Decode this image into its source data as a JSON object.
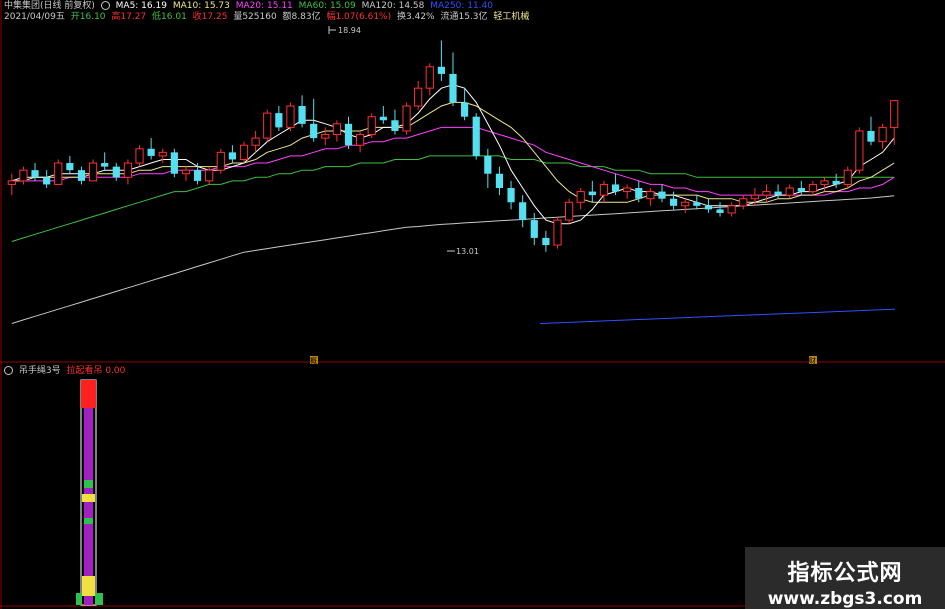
{
  "header": {
    "title": "中集集团(日线 前复权)",
    "ma5": "MA5: 16.19",
    "ma10": "MA10: 15.73",
    "ma20": "MA20: 15.11",
    "ma60": "MA60: 15.09",
    "ma120": "MA120: 14.58",
    "ma250": "MA250: 11.40",
    "date": "2021/04/09五",
    "open": "开16.10",
    "high": "高17.27",
    "low": "低16.01",
    "close": "收17.25",
    "volume": "量525160",
    "amount": "额8.83亿",
    "change": "幅1.07(6.61%)",
    "turnover": "换3.42%",
    "float": "流通15.3亿",
    "industry": "轻工机械"
  },
  "annotations": {
    "high_mark": "18.94",
    "low_mark": "13.01",
    "marker_left": "概",
    "marker_right": "财"
  },
  "sub_chart": {
    "name": "吊手绳3号",
    "indicator": "拉起看吊 0.00"
  },
  "watermark": {
    "line1": "指标公式网",
    "line2": "www.zbgs3.com"
  },
  "colors": {
    "up": "#ff3030",
    "down": "#54e0f0",
    "ma5": "#ffffff",
    "ma10": "#f0e68c",
    "ma20": "#ff40ff",
    "ma60": "#40c040",
    "ma120": "#c8c8c8",
    "ma250": "#3050ff",
    "grid": "#8b0000"
  },
  "chart_data": {
    "type": "candlestick",
    "ylim": [
      10.2,
      19.4
    ],
    "candles": [
      [
        14.9,
        15.2,
        14.6,
        15.0
      ],
      [
        15.0,
        15.4,
        14.9,
        15.3
      ],
      [
        15.3,
        15.5,
        15.0,
        15.1
      ],
      [
        15.1,
        15.3,
        14.8,
        14.9
      ],
      [
        14.9,
        15.6,
        14.9,
        15.5
      ],
      [
        15.5,
        15.7,
        15.2,
        15.3
      ],
      [
        15.3,
        15.4,
        14.9,
        15.0
      ],
      [
        15.0,
        15.6,
        15.0,
        15.5
      ],
      [
        15.5,
        15.8,
        15.3,
        15.4
      ],
      [
        15.4,
        15.5,
        15.0,
        15.1
      ],
      [
        15.1,
        15.6,
        14.9,
        15.5
      ],
      [
        15.5,
        16.0,
        15.4,
        15.9
      ],
      [
        15.9,
        16.2,
        15.6,
        15.7
      ],
      [
        15.7,
        15.9,
        15.5,
        15.8
      ],
      [
        15.8,
        15.9,
        15.1,
        15.2
      ],
      [
        15.2,
        15.4,
        15.0,
        15.3
      ],
      [
        15.3,
        15.5,
        14.9,
        15.0
      ],
      [
        15.0,
        15.4,
        14.9,
        15.3
      ],
      [
        15.3,
        15.9,
        15.2,
        15.8
      ],
      [
        15.8,
        16.0,
        15.5,
        15.6
      ],
      [
        15.6,
        16.1,
        15.5,
        16.0
      ],
      [
        16.0,
        16.4,
        15.8,
        16.2
      ],
      [
        16.2,
        17.0,
        16.1,
        16.9
      ],
      [
        16.9,
        17.1,
        16.4,
        16.5
      ],
      [
        16.5,
        17.2,
        16.4,
        17.1
      ],
      [
        17.1,
        17.4,
        16.5,
        16.6
      ],
      [
        16.6,
        17.3,
        16.1,
        16.2
      ],
      [
        16.2,
        16.5,
        16.0,
        16.3
      ],
      [
        16.3,
        16.7,
        16.1,
        16.6
      ],
      [
        16.6,
        16.8,
        15.9,
        16.0
      ],
      [
        16.0,
        16.4,
        15.8,
        16.3
      ],
      [
        16.3,
        16.9,
        16.2,
        16.8
      ],
      [
        16.8,
        17.1,
        16.6,
        16.7
      ],
      [
        16.7,
        17.0,
        16.3,
        16.4
      ],
      [
        16.4,
        17.2,
        16.3,
        17.1
      ],
      [
        17.1,
        17.8,
        17.0,
        17.6
      ],
      [
        17.6,
        18.3,
        17.4,
        18.2
      ],
      [
        18.2,
        18.94,
        17.8,
        18.0
      ],
      [
        18.0,
        18.6,
        17.1,
        17.2
      ],
      [
        17.2,
        17.6,
        16.7,
        16.8
      ],
      [
        16.8,
        16.9,
        15.6,
        15.7
      ],
      [
        15.7,
        15.9,
        14.8,
        15.2
      ],
      [
        15.2,
        15.4,
        14.6,
        14.8
      ],
      [
        14.8,
        15.0,
        14.2,
        14.4
      ],
      [
        14.4,
        14.6,
        13.7,
        13.9
      ],
      [
        13.9,
        14.1,
        13.2,
        13.4
      ],
      [
        13.4,
        13.6,
        13.01,
        13.2
      ],
      [
        13.2,
        14.0,
        13.1,
        13.9
      ],
      [
        13.9,
        14.5,
        13.8,
        14.4
      ],
      [
        14.4,
        14.8,
        14.2,
        14.7
      ],
      [
        14.7,
        15.0,
        14.4,
        14.6
      ],
      [
        14.6,
        15.0,
        14.4,
        14.9
      ],
      [
        14.9,
        15.2,
        14.6,
        14.7
      ],
      [
        14.7,
        14.9,
        14.5,
        14.8
      ],
      [
        14.8,
        15.0,
        14.4,
        14.5
      ],
      [
        14.5,
        14.8,
        14.3,
        14.7
      ],
      [
        14.7,
        14.9,
        14.4,
        14.5
      ],
      [
        14.5,
        14.7,
        14.2,
        14.3
      ],
      [
        14.3,
        14.5,
        14.1,
        14.4
      ],
      [
        14.4,
        14.6,
        14.2,
        14.3
      ],
      [
        14.3,
        14.5,
        14.1,
        14.2
      ],
      [
        14.2,
        14.4,
        14.0,
        14.1
      ],
      [
        14.1,
        14.4,
        14.0,
        14.3
      ],
      [
        14.3,
        14.6,
        14.2,
        14.5
      ],
      [
        14.5,
        14.8,
        14.3,
        14.6
      ],
      [
        14.6,
        14.9,
        14.4,
        14.7
      ],
      [
        14.7,
        14.9,
        14.5,
        14.6
      ],
      [
        14.6,
        14.9,
        14.5,
        14.8
      ],
      [
        14.8,
        15.0,
        14.6,
        14.7
      ],
      [
        14.7,
        15.0,
        14.6,
        14.9
      ],
      [
        14.9,
        15.1,
        14.7,
        15.0
      ],
      [
        15.0,
        15.2,
        14.8,
        14.9
      ],
      [
        14.9,
        15.4,
        14.8,
        15.3
      ],
      [
        15.3,
        16.5,
        15.2,
        16.4
      ],
      [
        16.4,
        16.8,
        16.0,
        16.1
      ],
      [
        16.1,
        16.6,
        15.9,
        16.5
      ],
      [
        16.5,
        17.27,
        16.01,
        17.25
      ]
    ],
    "ma5": [
      15.0,
      15.1,
      15.1,
      15.1,
      15.2,
      15.2,
      15.2,
      15.2,
      15.3,
      15.3,
      15.3,
      15.4,
      15.5,
      15.6,
      15.6,
      15.6,
      15.4,
      15.3,
      15.3,
      15.4,
      15.5,
      15.8,
      16.1,
      16.3,
      16.5,
      16.7,
      16.7,
      16.6,
      16.5,
      16.3,
      16.2,
      16.3,
      16.5,
      16.5,
      16.6,
      16.9,
      17.3,
      17.6,
      17.7,
      17.6,
      17.2,
      16.6,
      16.0,
      15.3,
      14.8,
      14.3,
      13.9,
      13.8,
      13.8,
      13.9,
      14.2,
      14.6,
      14.7,
      14.8,
      14.7,
      14.7,
      14.6,
      14.6,
      14.5,
      14.4,
      14.3,
      14.3,
      14.3,
      14.3,
      14.4,
      14.5,
      14.6,
      14.6,
      14.7,
      14.7,
      14.8,
      14.9,
      15.0,
      15.4,
      15.6,
      15.8,
      16.2
    ],
    "ma10": [
      15.0,
      15.0,
      15.1,
      15.1,
      15.1,
      15.1,
      15.1,
      15.2,
      15.2,
      15.2,
      15.2,
      15.3,
      15.3,
      15.4,
      15.4,
      15.4,
      15.4,
      15.4,
      15.4,
      15.5,
      15.5,
      15.6,
      15.8,
      15.9,
      16.0,
      16.2,
      16.3,
      16.4,
      16.4,
      16.4,
      16.4,
      16.5,
      16.5,
      16.5,
      16.5,
      16.7,
      16.9,
      17.1,
      17.2,
      17.2,
      17.1,
      16.9,
      16.7,
      16.5,
      16.2,
      15.8,
      15.4,
      15.0,
      14.7,
      14.5,
      14.4,
      14.4,
      14.4,
      14.4,
      14.5,
      14.6,
      14.6,
      14.6,
      14.6,
      14.6,
      14.5,
      14.5,
      14.5,
      14.4,
      14.4,
      14.4,
      14.5,
      14.5,
      14.6,
      14.6,
      14.7,
      14.7,
      14.8,
      15.0,
      15.1,
      15.3,
      15.5
    ],
    "ma20": [
      15.0,
      15.0,
      15.0,
      15.0,
      15.0,
      15.1,
      15.1,
      15.1,
      15.1,
      15.1,
      15.1,
      15.2,
      15.2,
      15.2,
      15.3,
      15.3,
      15.3,
      15.3,
      15.4,
      15.4,
      15.4,
      15.5,
      15.5,
      15.6,
      15.7,
      15.7,
      15.8,
      15.9,
      15.9,
      16.0,
      16.0,
      16.1,
      16.1,
      16.2,
      16.2,
      16.3,
      16.4,
      16.5,
      16.5,
      16.5,
      16.5,
      16.4,
      16.3,
      16.2,
      16.1,
      16.0,
      15.8,
      15.7,
      15.6,
      15.5,
      15.4,
      15.3,
      15.2,
      15.1,
      15.0,
      14.9,
      14.9,
      14.8,
      14.8,
      14.7,
      14.7,
      14.6,
      14.6,
      14.6,
      14.6,
      14.6,
      14.6,
      14.6,
      14.6,
      14.6,
      14.6,
      14.7,
      14.7,
      14.8,
      14.8,
      14.9,
      15.1
    ],
    "ma60": [
      13.3,
      13.4,
      13.5,
      13.6,
      13.7,
      13.8,
      13.9,
      14.0,
      14.1,
      14.2,
      14.3,
      14.4,
      14.5,
      14.6,
      14.7,
      14.7,
      14.8,
      14.9,
      14.9,
      15.0,
      15.0,
      15.1,
      15.1,
      15.2,
      15.2,
      15.3,
      15.3,
      15.4,
      15.4,
      15.4,
      15.5,
      15.5,
      15.5,
      15.6,
      15.6,
      15.6,
      15.7,
      15.7,
      15.7,
      15.7,
      15.7,
      15.7,
      15.7,
      15.6,
      15.6,
      15.6,
      15.5,
      15.5,
      15.5,
      15.4,
      15.4,
      15.4,
      15.3,
      15.3,
      15.3,
      15.2,
      15.2,
      15.2,
      15.2,
      15.1,
      15.1,
      15.1,
      15.1,
      15.1,
      15.1,
      15.1,
      15.1,
      15.1,
      15.1,
      15.1,
      15.1,
      15.1,
      15.1,
      15.1,
      15.1,
      15.1,
      15.1
    ],
    "ma120": [
      11.0,
      11.1,
      11.2,
      11.3,
      11.4,
      11.5,
      11.6,
      11.7,
      11.8,
      11.9,
      12.0,
      12.1,
      12.2,
      12.3,
      12.4,
      12.5,
      12.6,
      12.7,
      12.8,
      12.9,
      13.0,
      13.05,
      13.1,
      13.15,
      13.2,
      13.25,
      13.3,
      13.35,
      13.4,
      13.45,
      13.5,
      13.55,
      13.6,
      13.65,
      13.7,
      13.72,
      13.75,
      13.78,
      13.8,
      13.82,
      13.84,
      13.86,
      13.88,
      13.9,
      13.92,
      13.94,
      13.96,
      13.98,
      14.0,
      14.02,
      14.04,
      14.06,
      14.08,
      14.1,
      14.12,
      14.14,
      14.16,
      14.18,
      14.2,
      14.22,
      14.24,
      14.26,
      14.28,
      14.3,
      14.32,
      14.34,
      14.36,
      14.38,
      14.4,
      14.42,
      14.44,
      14.46,
      14.48,
      14.5,
      14.52,
      14.55,
      14.58
    ],
    "ma250": [
      11.0,
      11.04,
      11.08,
      11.12,
      11.16,
      11.2,
      11.24,
      11.28,
      11.32,
      11.36,
      11.4
    ],
    "sub_bars": {
      "value": 0.0
    }
  }
}
